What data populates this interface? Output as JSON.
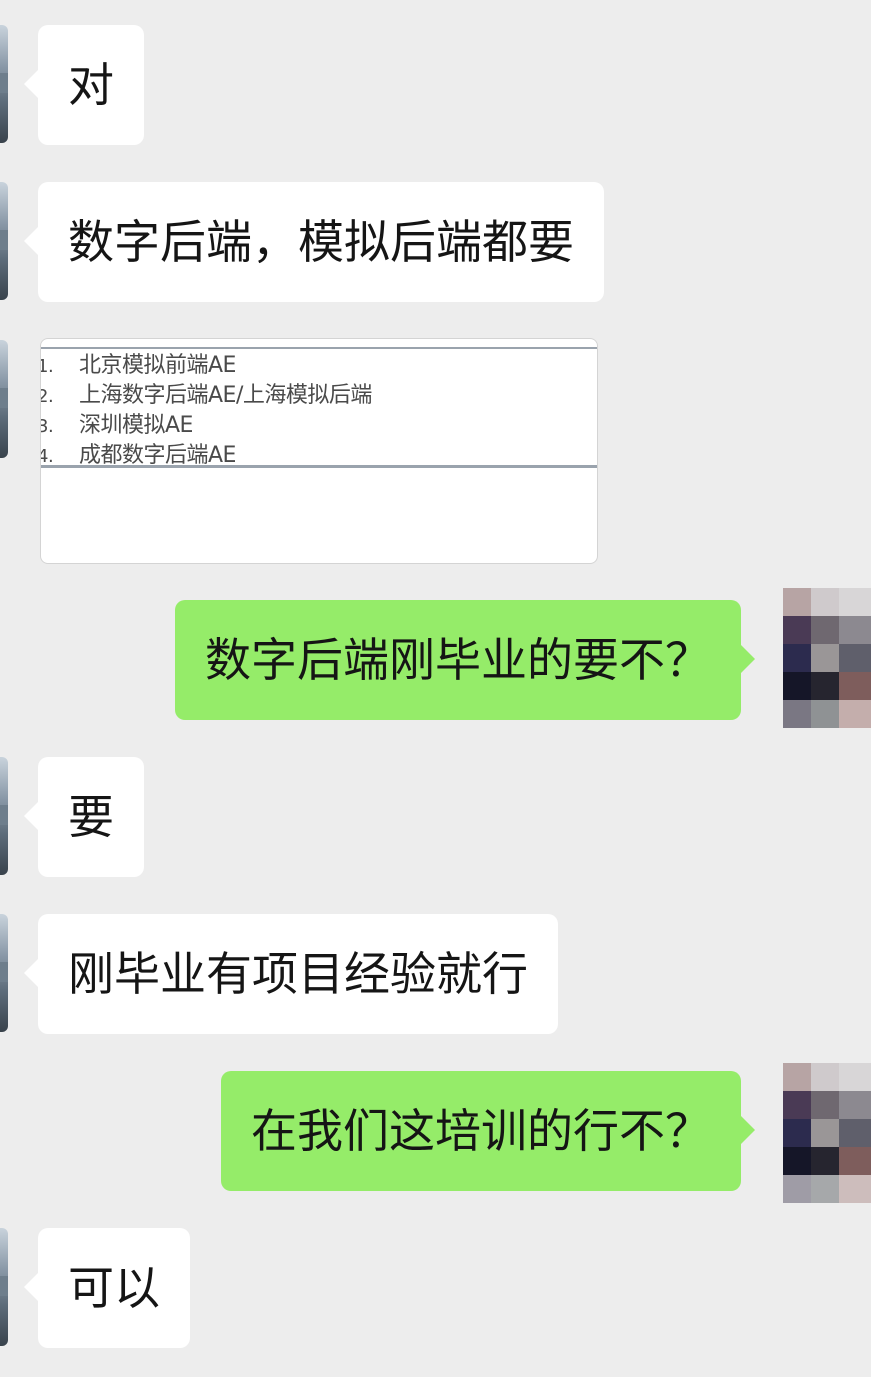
{
  "messages": [
    {
      "side": "in",
      "text": "对"
    },
    {
      "side": "in",
      "text": "数字后端，模拟后端都要"
    },
    {
      "side": "in",
      "type": "image",
      "list_items": [
        {
          "num": "1.",
          "text": "北京模拟前端AE"
        },
        {
          "num": "2.",
          "text": "上海数字后端AE/上海模拟后端"
        },
        {
          "num": "3.",
          "text": "深圳模拟AE"
        },
        {
          "num": "4.",
          "text": "成都数字后端AE"
        }
      ]
    },
    {
      "side": "out",
      "text": "数字后端刚毕业的要不？"
    },
    {
      "side": "in",
      "text": "要"
    },
    {
      "side": "in",
      "text": "刚毕业有项目经验就行"
    },
    {
      "side": "out",
      "text": "在我们这培训的行不？"
    },
    {
      "side": "in",
      "text": "可以"
    }
  ],
  "colors": {
    "background": "#ededed",
    "incoming_bubble": "#ffffff",
    "outgoing_bubble": "#95ec69"
  }
}
